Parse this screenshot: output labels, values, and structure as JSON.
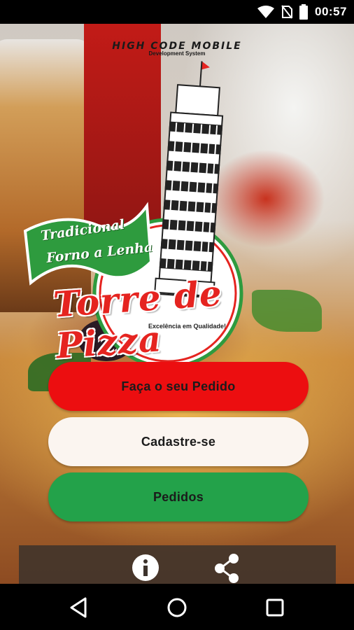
{
  "status_bar": {
    "time": "00:57",
    "icons": [
      "wifi-icon",
      "no-sim-icon",
      "battery-icon"
    ]
  },
  "header": {
    "brand_title": "HIGH CODE MOBILE",
    "brand_subtitle": "Development System"
  },
  "logo": {
    "banner_line1": "Tradicional",
    "banner_line2": "Forno a Lenha",
    "restaurant_name": "Torre de Pizza",
    "slogan": "Excelência em Qualidade!"
  },
  "menu": {
    "order_label": "Faça o seu Pedido",
    "register_label": "Cadastre-se",
    "orders_label": "Pedidos"
  },
  "bottom_bar": {
    "icons": [
      "info-icon",
      "share-icon"
    ]
  },
  "nav_bar": {
    "icons": [
      "back-icon",
      "home-icon",
      "recents-icon"
    ]
  },
  "colors": {
    "order_button": "#ec0e10",
    "register_button": "#fbf5f0",
    "orders_button": "#23a24a",
    "brand_red": "#e52420",
    "brand_green": "#2e9b3e"
  }
}
